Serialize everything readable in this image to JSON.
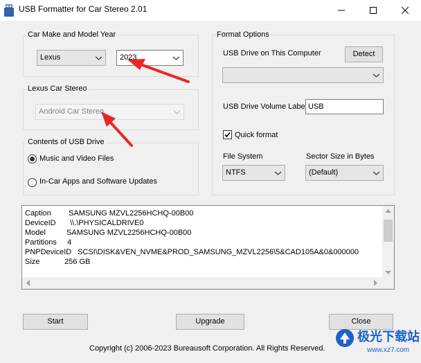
{
  "window": {
    "title": "USB Formatter for Car Stereo 2.01"
  },
  "car_group": {
    "label": "Car Make and Model Year",
    "make_value": "Lexus",
    "year_value": "2023"
  },
  "stereo_group": {
    "label": "Lexus Car Stereo",
    "stereo_value": "Android Car Stereo"
  },
  "contents_group": {
    "label": "Contents of USB Drive",
    "options": [
      {
        "label": "Music and Video Files",
        "selected": true
      },
      {
        "label": "In-Car Apps and Software Updates",
        "selected": false
      }
    ]
  },
  "format_group": {
    "label": "Format Options",
    "usb_drive_label": "USB Drive on This Computer",
    "detect_button": "Detect",
    "usb_drive_value": "",
    "volume_label_caption": "USB Drive Volume Label",
    "volume_label_value": "USB",
    "quick_format_label": "Quick format",
    "quick_format_checked": true,
    "file_system_label": "File System",
    "file_system_value": "NTFS",
    "sector_size_label": "Sector Size in Bytes",
    "sector_size_value": "(Default)"
  },
  "drive_info": [
    {
      "key": "Caption",
      "value": "SAMSUNG MZVL2256HCHQ-00B00"
    },
    {
      "key": "DeviceID",
      "value": "\\\\.\\PHYSICALDRIVE0"
    },
    {
      "key": "Model",
      "value": "SAMSUNG MZVL2256HCHQ-00B00"
    },
    {
      "key": "Partitions",
      "value": "4"
    },
    {
      "key": "PNPDeviceID",
      "value": "SCSI\\DISK&VEN_NVME&PROD_SAMSUNG_MZVL2256\\5&CAD105A&0&000000"
    },
    {
      "key": "Size",
      "value": "256 GB"
    }
  ],
  "buttons": {
    "start": "Start",
    "upgrade": "Upgrade",
    "close": "Close"
  },
  "footer": {
    "copyright": "Copyright (c) 2006-2023 Bureausoft Corporation. All Rights Reserved."
  },
  "watermark": {
    "text": "极光下载站",
    "url": "www.xz7.com"
  },
  "colors": {
    "annotation_arrow": "#e8262a",
    "watermark_blue": "#1a63c8"
  }
}
